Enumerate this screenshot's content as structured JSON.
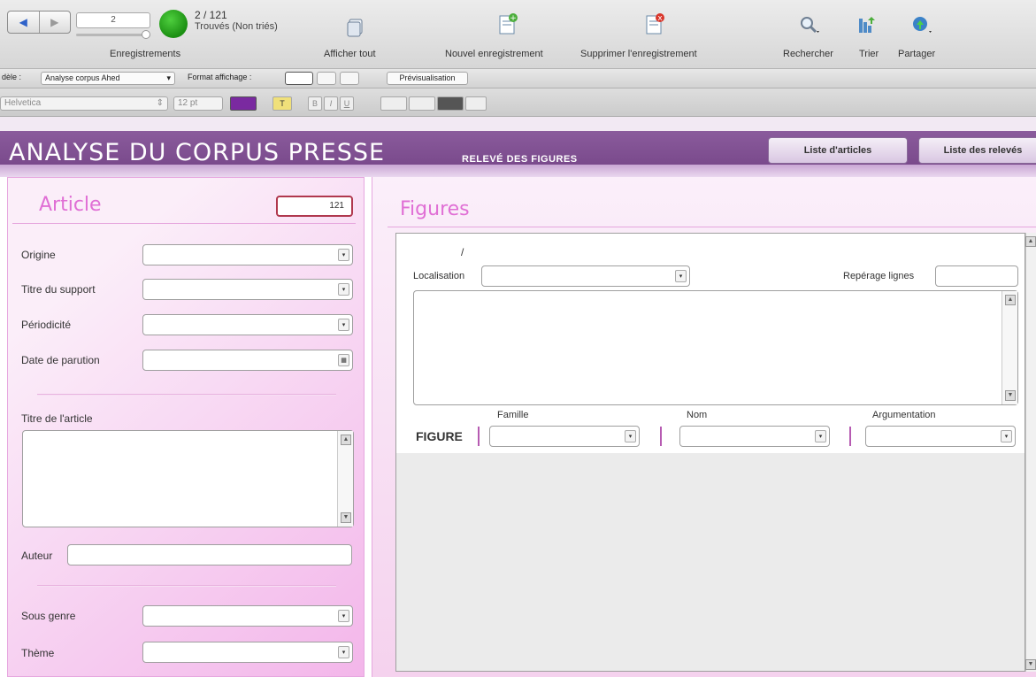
{
  "toolbar": {
    "record_field": "2",
    "found_count": "2 / 121",
    "found_label": "Trouvés (Non triés)",
    "records_label": "Enregistrements",
    "show_all_label": "Afficher tout",
    "new_record_label": "Nouvel enregistrement",
    "delete_record_label": "Supprimer l'enregistrement",
    "search_label": "Rechercher",
    "sort_label": "Trier",
    "share_label": "Partager"
  },
  "layout_bar": {
    "layout_label": "dèle :",
    "layout_value": "Analyse corpus Ahed",
    "display_format_label": "Format affichage :",
    "preview_label": "Prévisualisation"
  },
  "format_bar": {
    "font": "Helvetica",
    "size": "12 pt",
    "bold": "B",
    "italic": "I",
    "underline": "U",
    "highlight": "T"
  },
  "header": {
    "title": "Analyse du corpus presse",
    "subtitle": "Relevé des figures",
    "btn_articles": "Liste d'articles",
    "btn_releves": "Liste des relevés"
  },
  "article": {
    "title": "Article",
    "number": "121",
    "origin_label": "Origine",
    "support_label": "Titre du support",
    "periodicity_label": "Périodicité",
    "date_label": "Date de parution",
    "article_title_label": "Titre de l'article",
    "author_label": "Auteur",
    "subgenre_label": "Sous genre",
    "theme_label": "Thème"
  },
  "figures": {
    "title": "Figures",
    "slash": "/",
    "localisation_label": "Localisation",
    "reperage_label": "Repérage lignes",
    "figure_label": "FIGURE",
    "famille_label": "Famille",
    "nom_label": "Nom",
    "argumentation_label": "Argumentation"
  },
  "colors": {
    "header_purple": "#7a4a8c",
    "panel_pink": "#f3b6ea",
    "title_pink": "#e06fd5",
    "number_border": "#b0384e"
  }
}
